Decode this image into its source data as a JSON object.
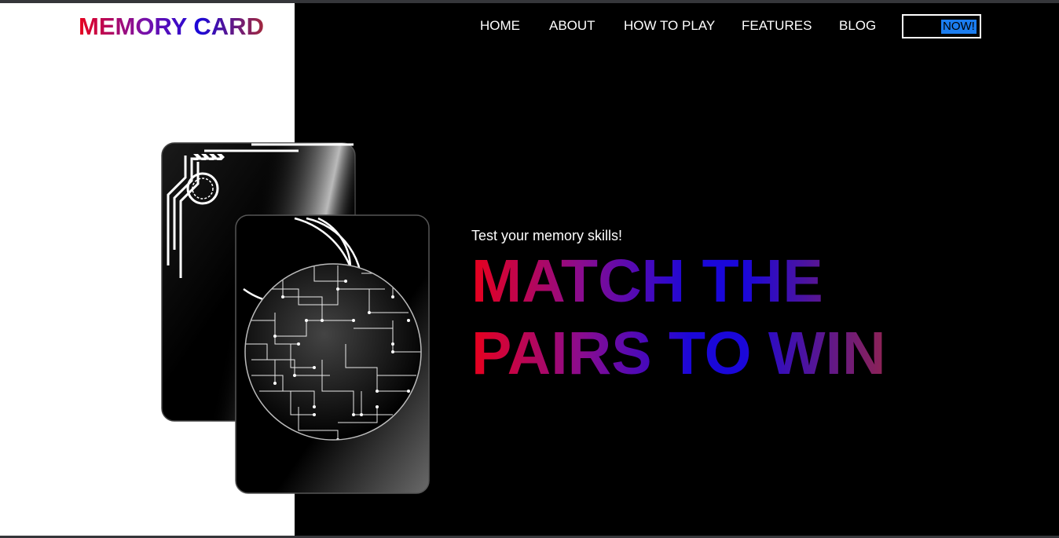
{
  "brand": {
    "name": "MEMORY CARD"
  },
  "nav": {
    "items": [
      {
        "label": "HOME"
      },
      {
        "label": "ABOUT"
      },
      {
        "label": "HOW TO PLAY"
      },
      {
        "label": "FEATURES"
      },
      {
        "label": "BLOG"
      }
    ],
    "cta_label": "NOW!"
  },
  "hero": {
    "tagline": "Test your memory skills!",
    "headline_line1": "MATCH THE",
    "headline_line2": "PAIRS TO WIN"
  },
  "colors": {
    "gradient_red": "#e8001c",
    "gradient_blue": "#1a07d9",
    "gradient_maroon": "#a3283c",
    "cta_highlight": "#1b7df0",
    "left_panel": "#ffffff",
    "right_panel": "#000000"
  },
  "icons": {
    "card_back": "circuit-card-icon",
    "card_front": "circuit-globe-icon"
  }
}
